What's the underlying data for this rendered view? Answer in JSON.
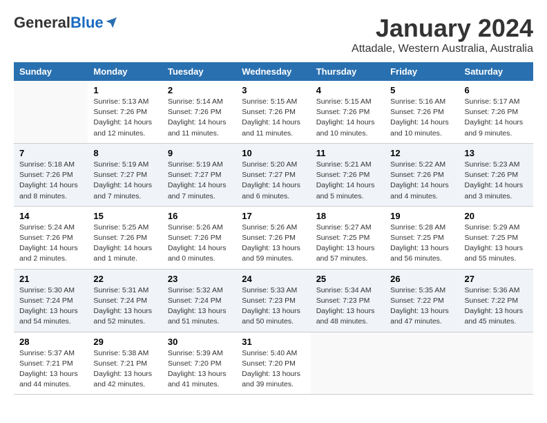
{
  "logo": {
    "general": "General",
    "blue": "Blue"
  },
  "title": "January 2024",
  "location": "Attadale, Western Australia, Australia",
  "headers": [
    "Sunday",
    "Monday",
    "Tuesday",
    "Wednesday",
    "Thursday",
    "Friday",
    "Saturday"
  ],
  "weeks": [
    [
      {
        "day": "",
        "content": ""
      },
      {
        "day": "1",
        "content": "Sunrise: 5:13 AM\nSunset: 7:26 PM\nDaylight: 14 hours\nand 12 minutes."
      },
      {
        "day": "2",
        "content": "Sunrise: 5:14 AM\nSunset: 7:26 PM\nDaylight: 14 hours\nand 11 minutes."
      },
      {
        "day": "3",
        "content": "Sunrise: 5:15 AM\nSunset: 7:26 PM\nDaylight: 14 hours\nand 11 minutes."
      },
      {
        "day": "4",
        "content": "Sunrise: 5:15 AM\nSunset: 7:26 PM\nDaylight: 14 hours\nand 10 minutes."
      },
      {
        "day": "5",
        "content": "Sunrise: 5:16 AM\nSunset: 7:26 PM\nDaylight: 14 hours\nand 10 minutes."
      },
      {
        "day": "6",
        "content": "Sunrise: 5:17 AM\nSunset: 7:26 PM\nDaylight: 14 hours\nand 9 minutes."
      }
    ],
    [
      {
        "day": "7",
        "content": "Sunrise: 5:18 AM\nSunset: 7:26 PM\nDaylight: 14 hours\nand 8 minutes."
      },
      {
        "day": "8",
        "content": "Sunrise: 5:19 AM\nSunset: 7:27 PM\nDaylight: 14 hours\nand 7 minutes."
      },
      {
        "day": "9",
        "content": "Sunrise: 5:19 AM\nSunset: 7:27 PM\nDaylight: 14 hours\nand 7 minutes."
      },
      {
        "day": "10",
        "content": "Sunrise: 5:20 AM\nSunset: 7:27 PM\nDaylight: 14 hours\nand 6 minutes."
      },
      {
        "day": "11",
        "content": "Sunrise: 5:21 AM\nSunset: 7:26 PM\nDaylight: 14 hours\nand 5 minutes."
      },
      {
        "day": "12",
        "content": "Sunrise: 5:22 AM\nSunset: 7:26 PM\nDaylight: 14 hours\nand 4 minutes."
      },
      {
        "day": "13",
        "content": "Sunrise: 5:23 AM\nSunset: 7:26 PM\nDaylight: 14 hours\nand 3 minutes."
      }
    ],
    [
      {
        "day": "14",
        "content": "Sunrise: 5:24 AM\nSunset: 7:26 PM\nDaylight: 14 hours\nand 2 minutes."
      },
      {
        "day": "15",
        "content": "Sunrise: 5:25 AM\nSunset: 7:26 PM\nDaylight: 14 hours\nand 1 minute."
      },
      {
        "day": "16",
        "content": "Sunrise: 5:26 AM\nSunset: 7:26 PM\nDaylight: 14 hours\nand 0 minutes."
      },
      {
        "day": "17",
        "content": "Sunrise: 5:26 AM\nSunset: 7:26 PM\nDaylight: 13 hours\nand 59 minutes."
      },
      {
        "day": "18",
        "content": "Sunrise: 5:27 AM\nSunset: 7:25 PM\nDaylight: 13 hours\nand 57 minutes."
      },
      {
        "day": "19",
        "content": "Sunrise: 5:28 AM\nSunset: 7:25 PM\nDaylight: 13 hours\nand 56 minutes."
      },
      {
        "day": "20",
        "content": "Sunrise: 5:29 AM\nSunset: 7:25 PM\nDaylight: 13 hours\nand 55 minutes."
      }
    ],
    [
      {
        "day": "21",
        "content": "Sunrise: 5:30 AM\nSunset: 7:24 PM\nDaylight: 13 hours\nand 54 minutes."
      },
      {
        "day": "22",
        "content": "Sunrise: 5:31 AM\nSunset: 7:24 PM\nDaylight: 13 hours\nand 52 minutes."
      },
      {
        "day": "23",
        "content": "Sunrise: 5:32 AM\nSunset: 7:24 PM\nDaylight: 13 hours\nand 51 minutes."
      },
      {
        "day": "24",
        "content": "Sunrise: 5:33 AM\nSunset: 7:23 PM\nDaylight: 13 hours\nand 50 minutes."
      },
      {
        "day": "25",
        "content": "Sunrise: 5:34 AM\nSunset: 7:23 PM\nDaylight: 13 hours\nand 48 minutes."
      },
      {
        "day": "26",
        "content": "Sunrise: 5:35 AM\nSunset: 7:22 PM\nDaylight: 13 hours\nand 47 minutes."
      },
      {
        "day": "27",
        "content": "Sunrise: 5:36 AM\nSunset: 7:22 PM\nDaylight: 13 hours\nand 45 minutes."
      }
    ],
    [
      {
        "day": "28",
        "content": "Sunrise: 5:37 AM\nSunset: 7:21 PM\nDaylight: 13 hours\nand 44 minutes."
      },
      {
        "day": "29",
        "content": "Sunrise: 5:38 AM\nSunset: 7:21 PM\nDaylight: 13 hours\nand 42 minutes."
      },
      {
        "day": "30",
        "content": "Sunrise: 5:39 AM\nSunset: 7:20 PM\nDaylight: 13 hours\nand 41 minutes."
      },
      {
        "day": "31",
        "content": "Sunrise: 5:40 AM\nSunset: 7:20 PM\nDaylight: 13 hours\nand 39 minutes."
      },
      {
        "day": "",
        "content": ""
      },
      {
        "day": "",
        "content": ""
      },
      {
        "day": "",
        "content": ""
      }
    ]
  ]
}
